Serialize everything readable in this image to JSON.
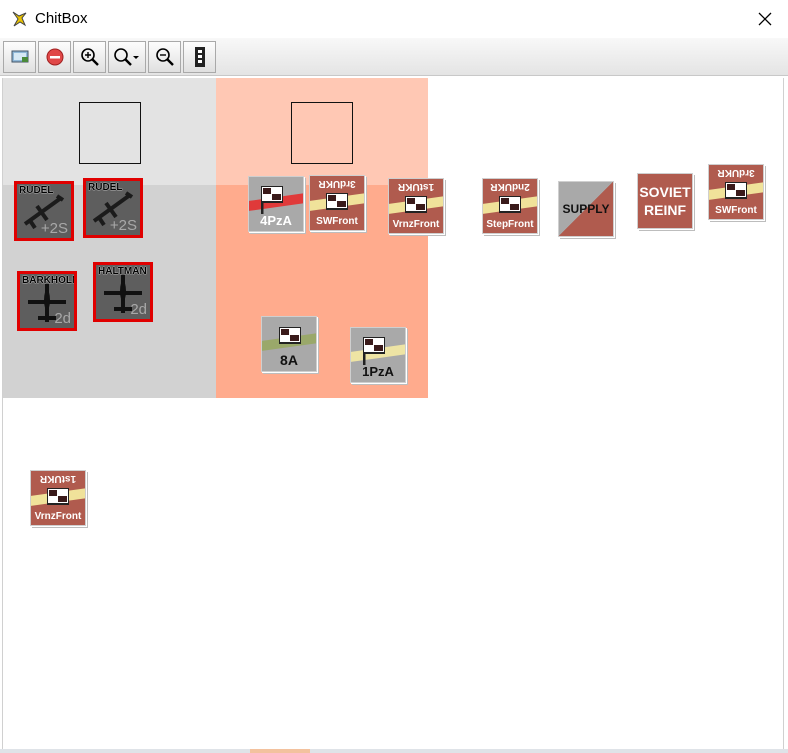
{
  "window": {
    "title": "ChitBox",
    "close_symbol": "✕"
  },
  "toolbar": {
    "buttons": [
      {
        "name": "screen-button",
        "icon": "screen-icon"
      },
      {
        "name": "stop-button",
        "icon": "stop-icon"
      },
      {
        "name": "zoom-in-button",
        "icon": "zoom-in-icon"
      },
      {
        "name": "zoom-menu-button",
        "icon": "zoom-dropdown-icon"
      },
      {
        "name": "zoom-out-button",
        "icon": "zoom-out-icon"
      },
      {
        "name": "counter-panel-button",
        "icon": "counter-panel-icon"
      }
    ]
  },
  "air_units": [
    {
      "name": "RUDEL",
      "value": "+2S"
    },
    {
      "name": "RUDEL",
      "value": "+2S"
    },
    {
      "name": "BARKHOLN",
      "value": "2d"
    },
    {
      "name": "HALTMAN",
      "value": "2d"
    }
  ],
  "counters": [
    {
      "label": "4PzA",
      "side": "axis"
    },
    {
      "label": "SWFront",
      "top": "3rdUKR",
      "side": "soviet"
    },
    {
      "label": "VrnzFront",
      "top": "1stUKR",
      "side": "soviet"
    },
    {
      "label": "StepFront",
      "top": "2ndUKR",
      "side": "soviet"
    },
    {
      "label": "SUPPLY",
      "side": "marker"
    },
    {
      "label1": "SOVIET",
      "label2": "REINF",
      "side": "marker"
    },
    {
      "label": "SWFront",
      "top": "3rdUKR",
      "side": "soviet"
    },
    {
      "label": "8A",
      "side": "axis"
    },
    {
      "label": "1PzA",
      "side": "axis"
    },
    {
      "label": "VrnzFront",
      "top": "1stUKR",
      "side": "soviet"
    }
  ],
  "colors": {
    "zone_grey": "#d2d2d2",
    "zone_salmon": "#ffaa8c",
    "soviet_counter": "#b05b4e",
    "axis_counter": "#a9a9a9",
    "air_border": "#e00000"
  }
}
